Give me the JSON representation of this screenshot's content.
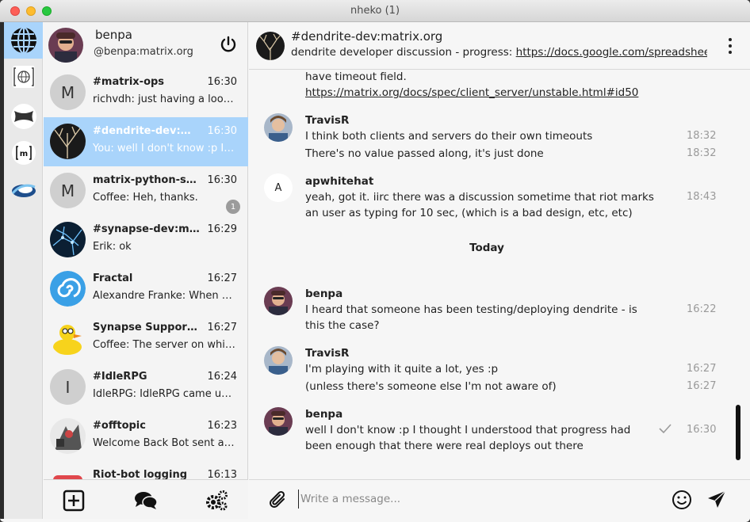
{
  "window": {
    "title": "nheko (1)"
  },
  "communities": [
    {
      "icon": "globe-icon",
      "active": true
    },
    {
      "icon": "matrix-globe-icon",
      "active": false
    },
    {
      "icon": "bone-shape-icon",
      "active": false
    },
    {
      "icon": "matrix-logo-icon",
      "active": false
    },
    {
      "icon": "swirl-logo-icon",
      "active": false
    }
  ],
  "user": {
    "display_name": "benpa",
    "user_id": "@benpa:matrix.org"
  },
  "rooms": [
    {
      "name": "#matrix-ops",
      "time": "16:30",
      "preview": "richvdh: just having a look at it",
      "avatar_letter": "M",
      "selected": false,
      "unread": ""
    },
    {
      "name": "#dendrite-dev:matrix.org",
      "time": "16:30",
      "preview": "You: well I don't know :p I thought",
      "avatar_letter": "",
      "selected": true,
      "unread": ""
    },
    {
      "name": "matrix-python-sdk",
      "time": "16:30",
      "preview": "Coffee: Heh, thanks.",
      "avatar_letter": "M",
      "selected": false,
      "unread": "1"
    },
    {
      "name": "#synapse-dev:matrix.org",
      "time": "16:29",
      "preview": "Erik: ok",
      "avatar_letter": "",
      "selected": false,
      "unread": ""
    },
    {
      "name": "Fractal",
      "time": "16:27",
      "preview": "Alexandre Franke: When something",
      "avatar_letter": "",
      "selected": false,
      "unread": ""
    },
    {
      "name": "Synapse Support Channel",
      "time": "16:27",
      "preview": "Coffee: The server on which it runs",
      "avatar_letter": "",
      "selected": false,
      "unread": ""
    },
    {
      "name": "#IdleRPG",
      "time": "16:24",
      "preview": "IdleRPG: IdleRPG came upon a",
      "avatar_letter": "I",
      "selected": false,
      "unread": ""
    },
    {
      "name": "#offtopic",
      "time": "16:23",
      "preview": "Welcome Back Bot sent a notice",
      "avatar_letter": "",
      "selected": false,
      "unread": ""
    },
    {
      "name": "Riot-bot logging",
      "time": "16:13",
      "preview": "",
      "avatar_letter": "",
      "selected": false,
      "unread": ""
    }
  ],
  "room": {
    "title": "#dendrite-dev:matrix.org",
    "topic_text": "dendrite developer discussion - progress: ",
    "topic_link": "https://docs.google.com/spreadsheets/d/"
  },
  "timeline": {
    "partial": {
      "line1": "have timeout field.",
      "link": "https://matrix.org/docs/spec/client_server/unstable.html#id50"
    },
    "groups": [
      {
        "sender": "TravisR",
        "lines": [
          {
            "text": "I think both clients and servers do their own timeouts",
            "time": "18:32"
          },
          {
            "text": "There's no value passed along, it's just done",
            "time": "18:32"
          }
        ]
      },
      {
        "sender": "apwhitehat",
        "avatar_letter": "A",
        "lines": [
          {
            "text": "yeah, got it. iirc there was a discussion sometime that riot marks",
            "time": "18:43"
          },
          {
            "text": "an user as typing for 10 sec, (which is a bad design, etc, etc)",
            "time": ""
          }
        ]
      },
      {
        "divider": "Today"
      },
      {
        "sender": "benpa",
        "lines": [
          {
            "text": "I heard that someone has been testing/deploying dendrite - is",
            "time": "16:22"
          },
          {
            "text": "this the case?",
            "time": ""
          }
        ]
      },
      {
        "sender": "TravisR",
        "lines": [
          {
            "text": "I'm playing with it quite a lot, yes :p",
            "time": "16:27"
          },
          {
            "text": "(unless there's someone else I'm not aware of)",
            "time": "16:27"
          }
        ]
      },
      {
        "sender": "benpa",
        "lines": [
          {
            "text": "well I don't know :p I thought I understood that progress had",
            "time": "16:30"
          },
          {
            "text": "been enough that there were real deploys out there",
            "time": ""
          }
        ]
      }
    ]
  },
  "composer": {
    "placeholder": "Write a message..."
  },
  "colors": {
    "selection": "#a9d4fb",
    "timestamp": "#9a9a9a"
  }
}
